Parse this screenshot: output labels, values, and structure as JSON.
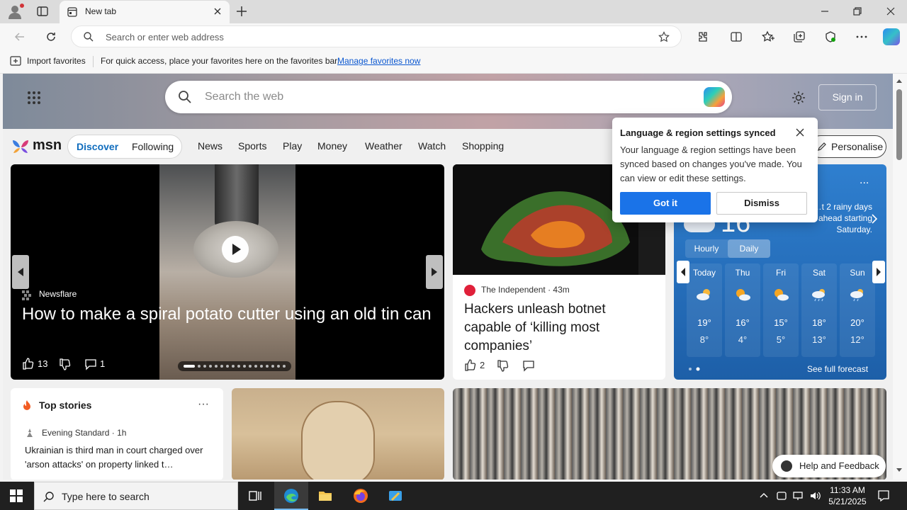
{
  "browser": {
    "tab_title": "New tab",
    "address_placeholder": "Search or enter web address"
  },
  "favorites_bar": {
    "import_label": "Import favorites",
    "hint": "For quick access, place your favorites here on the favorites bar.",
    "manage_link": "Manage favorites now"
  },
  "msn": {
    "search_placeholder": "Search the web",
    "sign_in": "Sign in",
    "logo_text": "msn",
    "feed_tabs": [
      "Discover",
      "Following"
    ],
    "nav": [
      "News",
      "Sports",
      "Play",
      "Money",
      "Weather",
      "Watch",
      "Shopping"
    ],
    "personalise": "Personalise"
  },
  "video_card": {
    "source": "Newsflare",
    "headline": "How to make a spiral potato cutter using an old tin can",
    "likes": "13",
    "comments": "1"
  },
  "news_card": {
    "source": "The Independent",
    "age": "43m",
    "headline": "Hackers unleash botnet capable of ‘killing most companies’",
    "likes": "2"
  },
  "weather": {
    "current_temp": "16",
    "summary": "…t 2 rainy days ahead starting Saturday.",
    "more": "...",
    "toggle": [
      "Hourly",
      "Daily"
    ],
    "see_full": "See full forecast",
    "days": [
      {
        "name": "Today",
        "high": "19°",
        "low": "8°",
        "icon": "partly-cloudy-icon"
      },
      {
        "name": "Thu",
        "high": "16°",
        "low": "4°",
        "icon": "sun-cloud-icon"
      },
      {
        "name": "Fri",
        "high": "15°",
        "low": "5°",
        "icon": "sun-cloud-icon"
      },
      {
        "name": "Sat",
        "high": "18°",
        "low": "13°",
        "icon": "rain-cloud-icon"
      },
      {
        "name": "Sun",
        "high": "20°",
        "low": "12°",
        "icon": "sun-rain-icon"
      }
    ]
  },
  "popup": {
    "title": "Language & region settings synced",
    "body": "Your language & region settings have been synced based on changes you've made. You can view or edit these settings.",
    "got_it": "Got it",
    "dismiss": "Dismiss"
  },
  "top_stories": {
    "heading": "Top stories",
    "more": "···",
    "source": "Evening Standard · 1h",
    "story": "Ukrainian is third man in court charged over 'arson attacks' on property linked t…"
  },
  "help_feedback": "Help and Feedback",
  "taskbar": {
    "search_placeholder": "Type here to search",
    "time": "11:33 AM",
    "date": "5/21/2025"
  },
  "colors": {
    "accent": "#0f6cbd",
    "button_blue": "#1a73e8",
    "weather_bg": "#2f7fcf",
    "taskbar": "#202020"
  }
}
